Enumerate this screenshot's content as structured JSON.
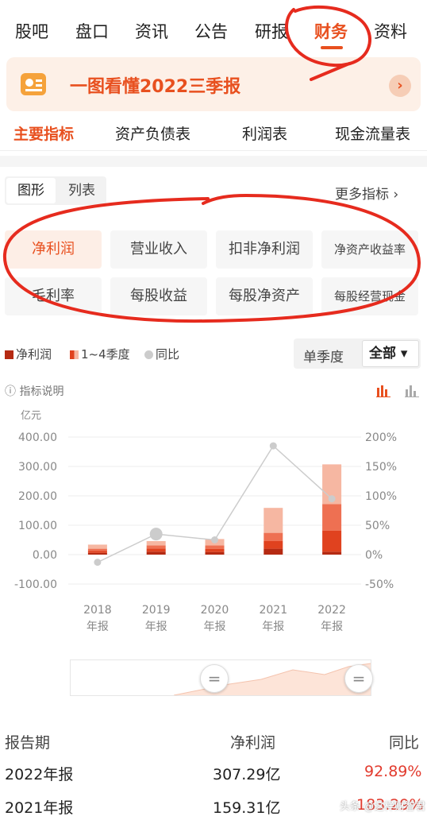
{
  "top_nav": {
    "items": [
      "股吧",
      "盘口",
      "资讯",
      "公告",
      "研报",
      "财务",
      "资料"
    ],
    "active_index": 5
  },
  "banner": {
    "title": "一图看懂2022三季报",
    "arrow": "›"
  },
  "sub_tabs": {
    "items": [
      "主要指标",
      "资产负债表",
      "利润表",
      "现金流量表"
    ],
    "active_index": 0
  },
  "view_toggle": {
    "graph": "图形",
    "list": "列表"
  },
  "more_metrics": "更多指标 ›",
  "metrics": [
    "净利润",
    "营业收入",
    "扣非净利润",
    "净资产收益率",
    "毛利率",
    "每股收益",
    "每股净资产",
    "每股经营现金"
  ],
  "active_metric_index": 0,
  "legend": {
    "net_profit": "净利润",
    "quarters": "1~4季度",
    "yoy": "同比"
  },
  "period_select": {
    "single_quarter": "单季度",
    "all": "全部 ▾"
  },
  "indicator_explain": "ⓘ 指标说明",
  "colors": {
    "accent": "#e8501f",
    "q1": "#b52a12",
    "q2": "#e0421f",
    "q3": "#ee7052",
    "q4": "#f6b7a2",
    "yoy_line": "#cccccc",
    "negative": "#e23b2e"
  },
  "chart_data": {
    "type": "bar",
    "unit_label": "亿元",
    "categories": [
      "2018\n年报",
      "2019\n年报",
      "2020\n年报",
      "2021\n年报",
      "2022\n年报"
    ],
    "category_lines": [
      [
        "2018",
        "年报"
      ],
      [
        "2019",
        "年报"
      ],
      [
        "2020",
        "年报"
      ],
      [
        "2021",
        "年报"
      ],
      [
        "2022",
        "年报"
      ]
    ],
    "left_axis": {
      "ticks": [
        "400.00",
        "300.00",
        "200.00",
        "100.00",
        "0.00",
        "-100.00"
      ],
      "range": [
        -100,
        400
      ]
    },
    "right_axis": {
      "ticks": [
        "200%",
        "150%",
        "100%",
        "50%",
        "0%",
        "-50%"
      ],
      "range": [
        -50,
        200
      ]
    },
    "series": [
      {
        "name": "1季度",
        "values": [
          6,
          10,
          9,
          20,
          10
        ]
      },
      {
        "name": "2季度",
        "values": [
          7,
          11,
          10,
          26,
          72
        ]
      },
      {
        "name": "3季度",
        "values": [
          7,
          10,
          12,
          28,
          90
        ]
      },
      {
        "name": "4季度",
        "values": [
          14,
          15,
          22,
          85,
          135
        ]
      }
    ],
    "yoy": [
      -13,
      35,
      25,
      185,
      95
    ]
  },
  "table": {
    "headers": [
      "报告期",
      "净利润",
      "同比"
    ],
    "rows": [
      [
        "2022年报",
        "307.29亿",
        "92.89%"
      ],
      [
        "2021年报",
        "159.31亿",
        "183.29%"
      ]
    ]
  },
  "watermark": "头条 @这样财智君"
}
